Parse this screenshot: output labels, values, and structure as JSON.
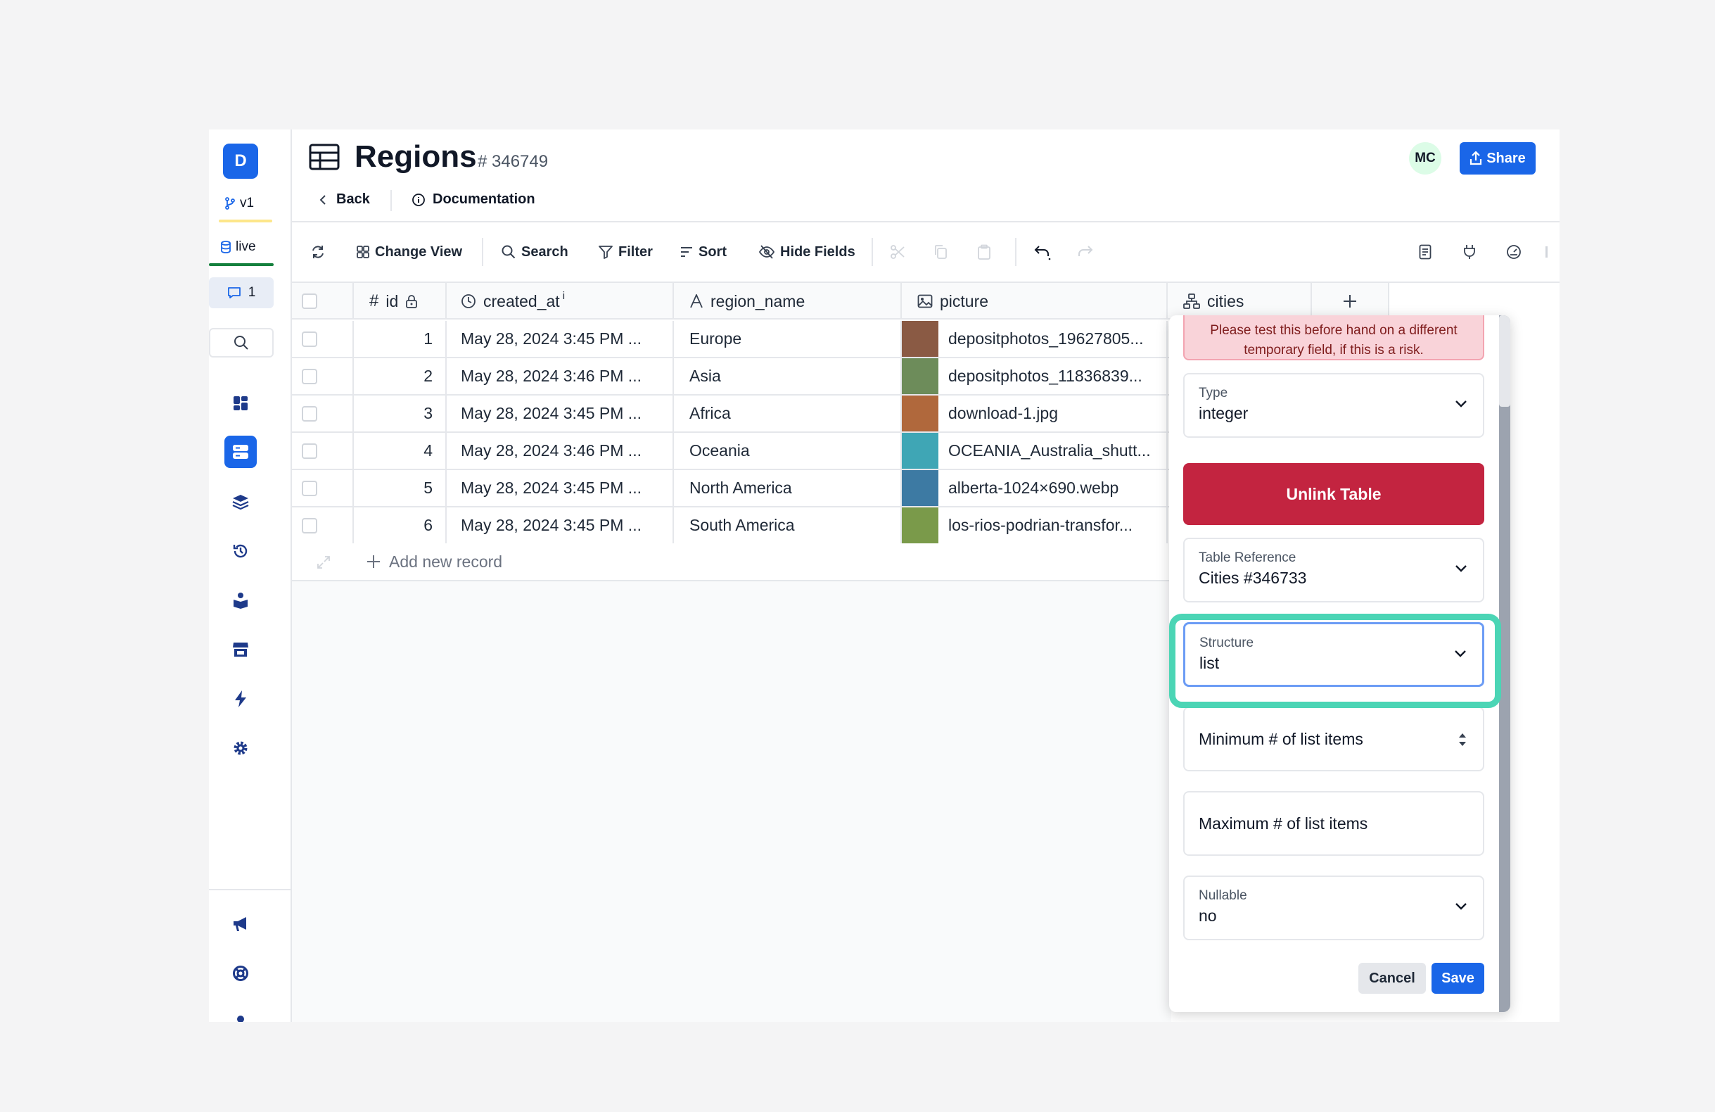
{
  "sidebar": {
    "logo_letter": "D",
    "branch": "v1",
    "environment": "live",
    "comments_count": "1"
  },
  "header": {
    "title": "Regions",
    "table_id": "# 346749",
    "back_label": "Back",
    "documentation_label": "Documentation",
    "avatar_initials": "MC",
    "share_label": "Share"
  },
  "toolbar": {
    "change_view": "Change View",
    "search": "Search",
    "filter": "Filter",
    "sort": "Sort",
    "hide_fields": "Hide Fields"
  },
  "grid": {
    "columns": [
      "id",
      "created_at",
      "region_name",
      "picture",
      "cities"
    ],
    "created_at_suffix": "i",
    "rows": [
      {
        "id": "1",
        "created_at": "May 28, 2024 3:45 PM ...",
        "region_name": "Europe",
        "picture": "depositphotos_19627805...",
        "thumb_color": "#8a5a44"
      },
      {
        "id": "2",
        "created_at": "May 28, 2024 3:46 PM ...",
        "region_name": "Asia",
        "picture": "depositphotos_11836839...",
        "thumb_color": "#6d8c5a"
      },
      {
        "id": "3",
        "created_at": "May 28, 2024 3:45 PM ...",
        "region_name": "Africa",
        "picture": "download-1.jpg",
        "thumb_color": "#b0683c"
      },
      {
        "id": "4",
        "created_at": "May 28, 2024 3:46 PM ...",
        "region_name": "Oceania",
        "picture": "OCEANIA_Australia_shutt...",
        "thumb_color": "#3fa6b5"
      },
      {
        "id": "5",
        "created_at": "May 28, 2024 3:45 PM ...",
        "region_name": "North America",
        "picture": "alberta-1024×690.webp",
        "thumb_color": "#3d7aa3"
      },
      {
        "id": "6",
        "created_at": "May 28, 2024 3:45 PM ...",
        "region_name": "South America",
        "picture": "los-rios-podrian-transfor...",
        "thumb_color": "#7a9a4a"
      }
    ],
    "add_record": "Add new record"
  },
  "panel": {
    "warning_line1": "Please test this before hand on a different",
    "warning_line2": "temporary field, if this is a risk.",
    "type_label": "Type",
    "type_value": "integer",
    "unlink_label": "Unlink Table",
    "table_ref_label": "Table Reference",
    "table_ref_value": "Cities #346733",
    "structure_label": "Structure",
    "structure_value": "list",
    "min_items": "Minimum # of list items",
    "max_items": "Maximum # of list items",
    "nullable_label": "Nullable",
    "nullable_value": "no",
    "cancel": "Cancel",
    "save": "Save"
  },
  "colors": {
    "accent": "#1a66e8",
    "danger": "#c32440",
    "highlight": "#4bd5b5"
  }
}
